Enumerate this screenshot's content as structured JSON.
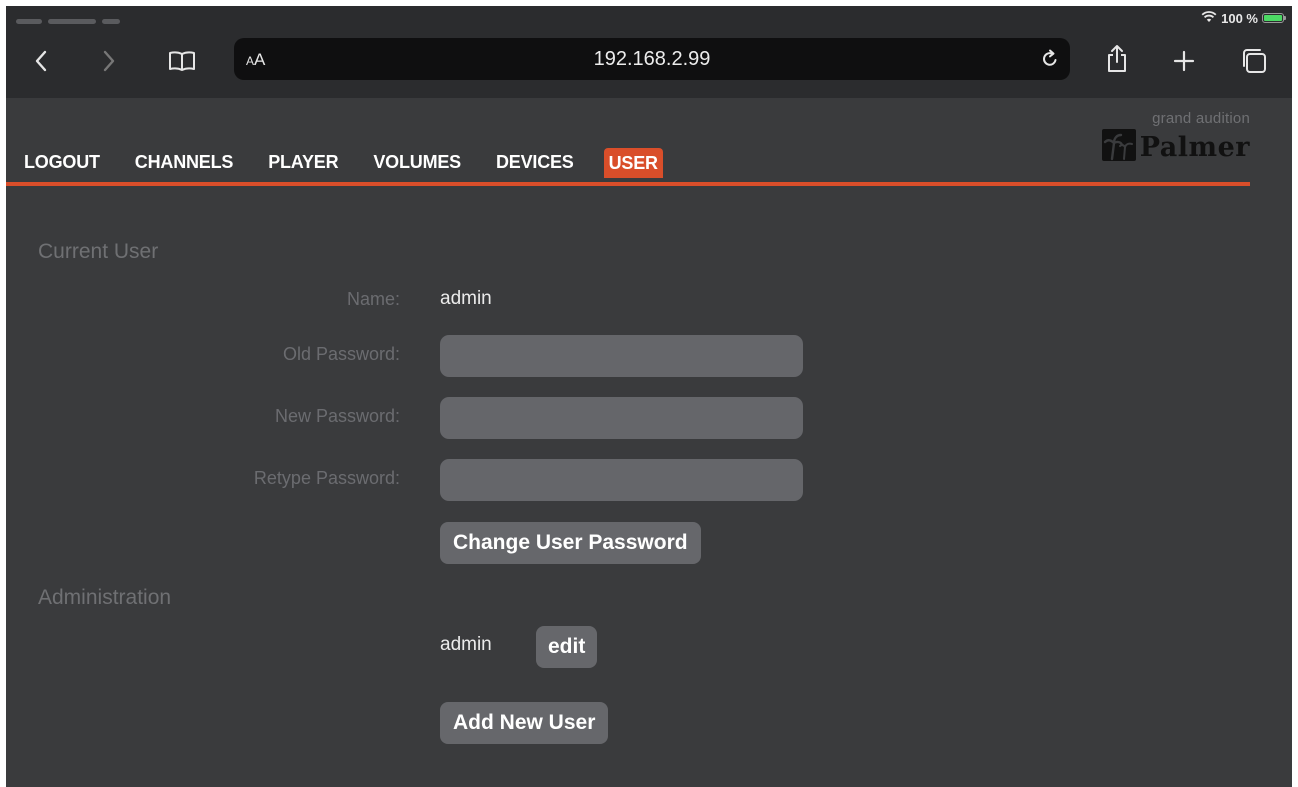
{
  "status_bar": {
    "battery": "100 %"
  },
  "browser": {
    "text_size_button": "AA",
    "url": "192.168.2.99"
  },
  "menu": {
    "items": [
      {
        "label": "LOGOUT"
      },
      {
        "label": "CHANNELS"
      },
      {
        "label": "PLAYER"
      },
      {
        "label": "VOLUMES"
      },
      {
        "label": "DEVICES"
      },
      {
        "label": "USER",
        "active": true
      }
    ]
  },
  "logo": {
    "tagline": "grand audition",
    "brand": "Palmer"
  },
  "current_user": {
    "section_title": "Current User",
    "name_label": "Name:",
    "name_value": "admin",
    "old_password_label": "Old Password:",
    "new_password_label": "New Password:",
    "retype_password_label": "Retype Password:",
    "old_password_value": "",
    "new_password_value": "",
    "retype_password_value": "",
    "change_button": "Change User Password"
  },
  "administration": {
    "section_title": "Administration",
    "users": [
      {
        "name": "admin",
        "edit_label": "edit"
      }
    ],
    "add_button": "Add New User"
  },
  "colors": {
    "accent": "#d94e2a",
    "background": "#3a3b3d",
    "browser_bar": "#2b2c2e",
    "input": "#65666a"
  }
}
